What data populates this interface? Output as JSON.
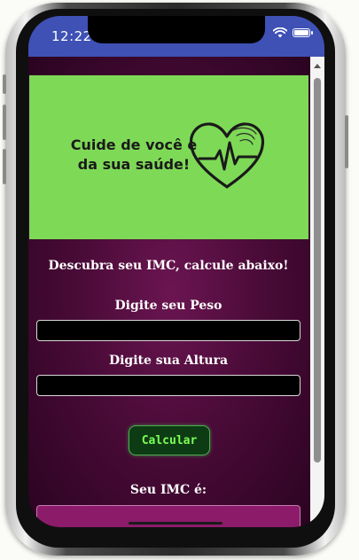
{
  "status_bar": {
    "time": "12:22",
    "wifi_icon": "wifi-icon",
    "battery_icon": "battery-icon",
    "color": "#3f51b5"
  },
  "banner": {
    "text_line1": "Cuide de você e",
    "text_line2": "da sua saúde!",
    "icon": "heart-pulse-icon",
    "background": "#7ed957"
  },
  "form": {
    "headline": "Descubra seu IMC, calcule abaixo!",
    "weight_label": "Digite seu Peso",
    "weight_value": "",
    "height_label": "Digite sua Altura",
    "height_value": "",
    "calculate_button": "Calcular",
    "result_label": "Seu IMC é:",
    "result_value": ""
  },
  "colors": {
    "page_background": "#4a0b38",
    "button_text": "#7bff57",
    "result_box": "#8c1b6a"
  }
}
